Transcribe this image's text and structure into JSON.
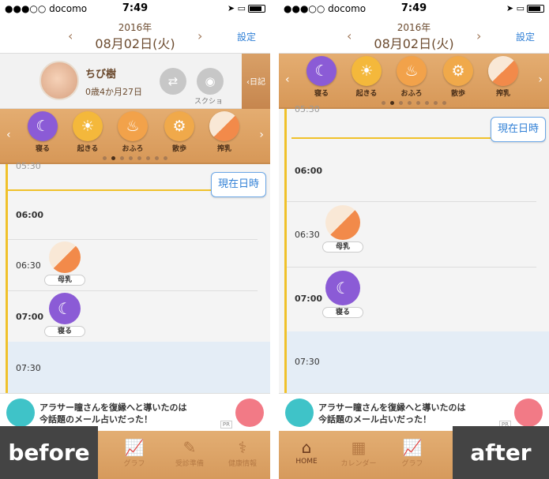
{
  "status": {
    "carrier": "●●●○○ docomo",
    "time": "7:49"
  },
  "header": {
    "year": "2016年",
    "date": "08月02日(火)",
    "prev": "‹",
    "next": "›",
    "settings": "設定"
  },
  "profile": {
    "name": "ちび樹",
    "age": "0歳4か月27日",
    "screenshot_label": "スクショ",
    "diary_label": "‹日記"
  },
  "actions": [
    {
      "label": "寝る",
      "icon": "moon-icon"
    },
    {
      "label": "起きる",
      "icon": "sun-icon"
    },
    {
      "label": "おふろ",
      "icon": "bath-icon"
    },
    {
      "label": "散歩",
      "icon": "stroller-icon"
    },
    {
      "label": "搾乳",
      "icon": "milk-icon"
    }
  ],
  "timeline": {
    "now_button": "現在日時",
    "top_partial": "05:30",
    "t1": "06:00",
    "t2": "06:30",
    "t3": "07:00",
    "t4": "07:30",
    "events": [
      {
        "time": "06:30",
        "label": "母乳",
        "icon": "breastfeeding-icon"
      },
      {
        "time": "07:00",
        "label": "寝る",
        "icon": "moon-icon"
      }
    ]
  },
  "ad": {
    "line1": "アラサー瞳さんを復縁へと導いたのは",
    "line2": "今話題のメール占いだった！",
    "pr": "PR"
  },
  "left_tabs": [
    "グラフ",
    "受診準備",
    "健康情報"
  ],
  "right_tabs": [
    "HOME",
    "カレンダー",
    "グラフ"
  ],
  "captions": {
    "before": "before",
    "after": "after"
  },
  "colors": {
    "accent": "#2f7fd6",
    "wood": "#dda266",
    "sleep": "#8b5bd6",
    "timeline": "#f0c12a"
  }
}
